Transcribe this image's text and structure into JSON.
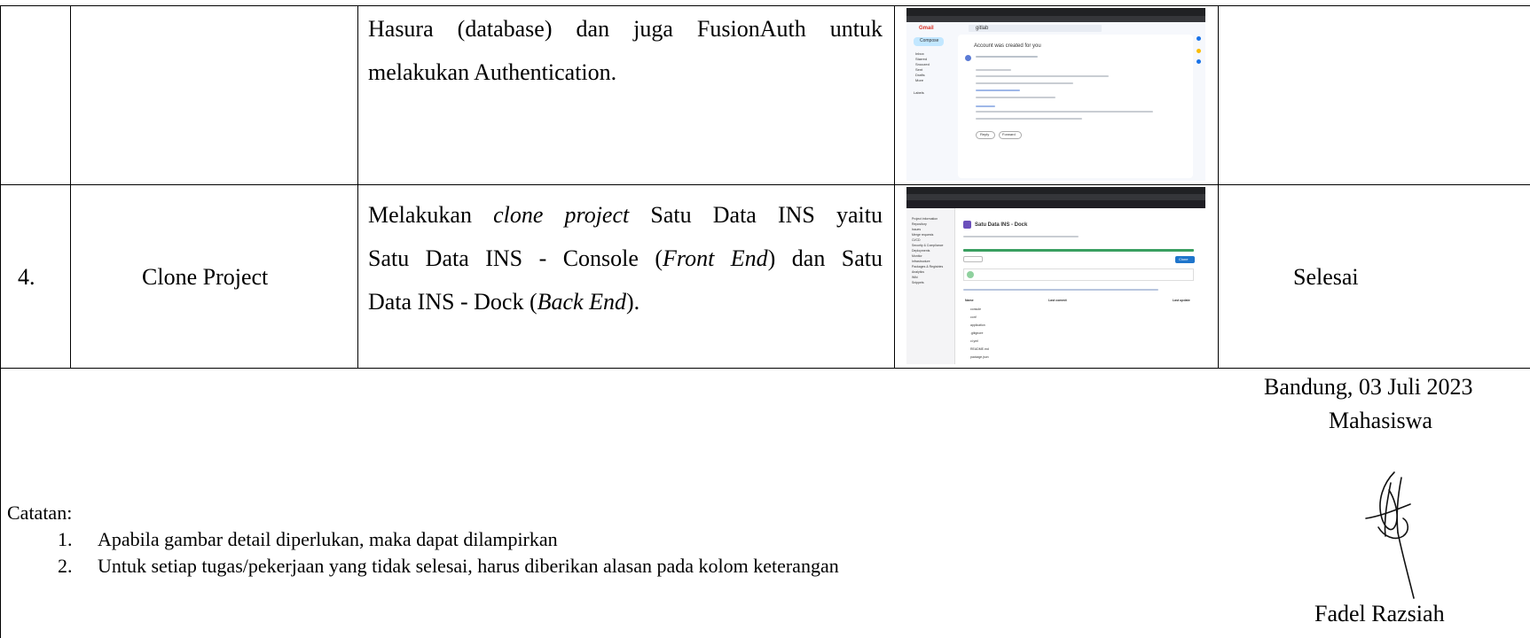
{
  "rows": [
    {
      "no": "",
      "task": "",
      "description_lines": [
        "Hasura (database) dan juga FusionAuth untuk",
        "melakukan Authentication."
      ],
      "status": "",
      "screenshot": {
        "app": "Gmail",
        "search": "gitlab",
        "subject": "Account was created for you",
        "compose": "Compose",
        "sidebar": [
          "Inbox",
          "Starred",
          "Snoozed",
          "Sent",
          "Drafts",
          "More"
        ],
        "labels_heading": "Labels",
        "reply": "Reply",
        "forward": "Forward"
      }
    },
    {
      "no": "4.",
      "task": "Clone Project",
      "description_lines": [
        "Melakukan clone project Satu Data INS yaitu",
        "Satu Data INS - Console (Front End) dan Satu",
        "Data INS - Dock (Back End)."
      ],
      "status": "Selesai",
      "screenshot": {
        "project_title": "Satu Data INS - Dock",
        "sidebar": [
          "Project information",
          "Repository",
          "Issues",
          "Merge requests",
          "CI/CD",
          "Security & Compliance",
          "Deployments",
          "Monitor",
          "Infrastructure",
          "Packages & Registries",
          "Analytics",
          "Wiki",
          "Snippets"
        ],
        "table_headers": [
          "Name",
          "Last commit",
          "Last update"
        ],
        "files": [
          "console",
          "conf",
          "application",
          ".gitignore",
          "ci.yml",
          "README.md",
          "package.json"
        ],
        "clone_button": "Clone"
      }
    }
  ],
  "footer": {
    "place_date": "Bandung, 03 Juli 2023",
    "role": "Mahasiswa",
    "name": "Fadel Razsiah",
    "notes_heading": "Catatan:",
    "notes": [
      {
        "num": "1.",
        "text": "Apabila gambar detail diperlukan, maka dapat dilampirkan"
      },
      {
        "num": "2.",
        "text": "Untuk setiap tugas/pekerjaan yang tidak selesai, harus diberikan alasan pada kolom keterangan"
      }
    ]
  }
}
